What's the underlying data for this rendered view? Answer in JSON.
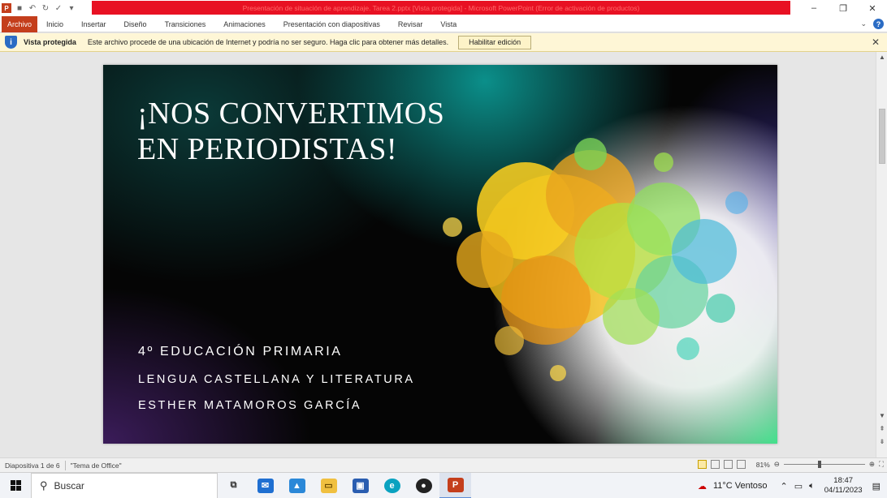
{
  "window": {
    "title": "Presentación de situación de aprendizaje. Tarea 2.pptx [Vista protegida] - Microsoft PowerPoint (Error de activación de productos)",
    "controls": {
      "minimize": "–",
      "restore": "❐",
      "close": "✕"
    }
  },
  "quick_access": {
    "app_icon": "P"
  },
  "ribbon": {
    "tabs": [
      {
        "label": "Archivo"
      },
      {
        "label": "Inicio"
      },
      {
        "label": "Insertar"
      },
      {
        "label": "Diseño"
      },
      {
        "label": "Transiciones"
      },
      {
        "label": "Animaciones"
      },
      {
        "label": "Presentación con diapositivas"
      },
      {
        "label": "Revisar"
      },
      {
        "label": "Vista"
      }
    ],
    "help": "?"
  },
  "protected_view": {
    "title": "Vista protegida",
    "message": "Este archivo procede de una ubicación de Internet y podría no ser seguro. Haga clic para obtener más detalles.",
    "button": "Habilitar edición",
    "icon": "shield-icon"
  },
  "slide": {
    "title_line1": "¡NOS CONVERTIMOS",
    "title_line2": "EN PERIODISTAS!",
    "subtitle1": "4º EDUCACIÓN PRIMARIA",
    "subtitle2": "LENGUA CASTELLANA Y LITERATURA",
    "subtitle3": "ESTHER MATAMOROS GARCÍA"
  },
  "status": {
    "slide_info": "Diapositiva 1 de 6",
    "theme": "\"Tema de Office\"",
    "zoom": "81%"
  },
  "taskbar": {
    "search_placeholder": "Buscar",
    "weather": "11°C  Ventoso",
    "time": "18:47",
    "date": "04/11/2023"
  },
  "colors": {
    "file_tab": "#c43e1c",
    "title_bar_red": "#e81123",
    "protected_bar": "#fef6d6"
  }
}
